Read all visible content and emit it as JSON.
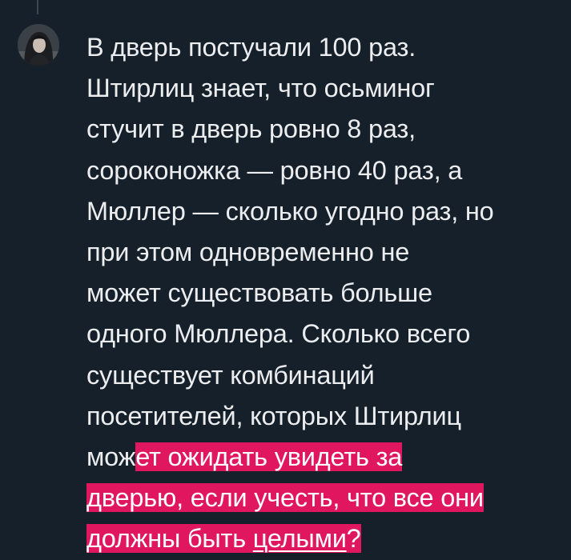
{
  "post": {
    "lines": [
      "В дверь постучали 100 раз.",
      "Штирлиц знает, что осьминог",
      "стучит в дверь ровно 8 раз,",
      "сороконожка — ровно 40 раз, а",
      "Мюллер — сколько угодно раз, но",
      "при этом одновременно не",
      "может существовать больше",
      "одного Мюллера. Сколько всего",
      "существует комбинаций",
      "посетителей, которых Штирлиц"
    ],
    "line11_plain": "мож",
    "line11_highlight": "ет ожидать увидеть за",
    "line12_highlight": "дверью, если учесть, что все они",
    "line13_highlight_start": "должны быть ",
    "line13_underlined": "целыми",
    "line13_highlight_end": "?"
  },
  "colors": {
    "background": "#16202b",
    "text": "#ecedef",
    "highlight": "#e0175e"
  },
  "icons": {
    "avatar": "user-avatar"
  }
}
